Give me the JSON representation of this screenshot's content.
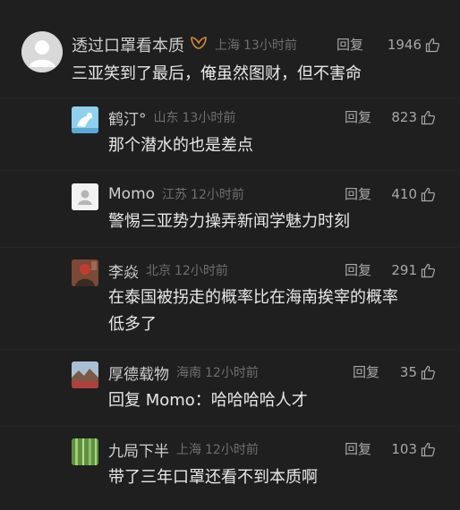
{
  "comments": [
    {
      "username": "透过口罩看本质",
      "badge": "vip-badge-icon",
      "location": "上海",
      "time": "13小时前",
      "reply": "回复",
      "likes": "1946",
      "text": "三亚笑到了最后，俺虽然图财，但不害命"
    },
    {
      "username": "鹤汀°",
      "location": "山东",
      "time": "13小时前",
      "reply": "回复",
      "likes": "823",
      "text": "那个潜水的也是差点"
    },
    {
      "username": "Momo",
      "location": "江苏",
      "time": "12小时前",
      "reply": "回复",
      "likes": "410",
      "text": "警惕三亚势力操弄新闻学魅力时刻"
    },
    {
      "username": "李焱",
      "location": "北京",
      "time": "12小时前",
      "reply": "回复",
      "likes": "291",
      "text_line1": "在泰国被拐走的概率比在海南挨宰的概率",
      "text_line2": "低多了"
    },
    {
      "username": "厚德载物",
      "location": "海南",
      "time": "12小时前",
      "reply": "回复",
      "likes": "35",
      "text": "回复 Momo：哈哈哈哈人才"
    },
    {
      "username": "九局下半",
      "location": "上海",
      "time": "12小时前",
      "reply": "回复",
      "likes": "103",
      "text": "带了三年口罩还看不到本质啊"
    }
  ],
  "colors": {
    "background": "#1f1f1f",
    "text": "#e8e8e8",
    "muted": "#6f6f6f",
    "badge": "#d18a3a"
  }
}
